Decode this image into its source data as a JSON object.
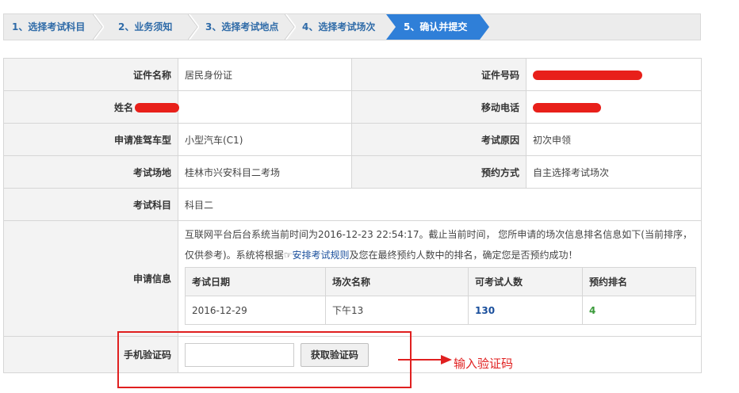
{
  "steps": [
    {
      "label": "1、选择考试科目"
    },
    {
      "label": "2、业务须知"
    },
    {
      "label": "3、选择考试地点"
    },
    {
      "label": "4、选择考试场次"
    },
    {
      "label": "5、确认并提交"
    }
  ],
  "form": {
    "id_type_label": "证件名称",
    "id_type_value": "居民身份证",
    "id_number_label": "证件号码",
    "name_label": "姓名",
    "mobile_label": "移动电话",
    "license_type_label": "申请准驾车型",
    "license_type_value": "小型汽车(C1)",
    "exam_reason_label": "考试原因",
    "exam_reason_value": "初次申领",
    "exam_site_label": "考试场地",
    "exam_site_value": "桂林市兴安科目二考场",
    "booking_method_label": "预约方式",
    "booking_method_value": "自主选择考试场次",
    "exam_subject_label": "考试科目",
    "exam_subject_value": "科目二",
    "application_info_label": "申请信息",
    "note_part1": "互联网平台后台系统当前时间为2016-12-23 22:54:17。截止当前时间， 您所申请的场次信息排名信息如下(当前排序，仅供参考)。系统将根据",
    "rule_link": "安排考试规则",
    "note_part2": "及您在最终预约人数中的排名，确定您是否预约成功！",
    "verify_code_label": "手机验证码",
    "verify_code_placeholder": "",
    "get_code_button": "获取验证码"
  },
  "schedule_table": {
    "headers": [
      "考试日期",
      "场次名称",
      "可考试人数",
      "预约排名"
    ],
    "rows": [
      [
        "2016-12-29",
        "下午13",
        "130",
        "4"
      ]
    ]
  },
  "annotation": {
    "hint_text": "输入验证码"
  },
  "colors": {
    "accent": "#2f7fd8",
    "step_text": "#2f6ba8",
    "annotation_red": "#e02020",
    "count_blue": "#1a4f9c",
    "rank_green": "#3a9a3a"
  }
}
